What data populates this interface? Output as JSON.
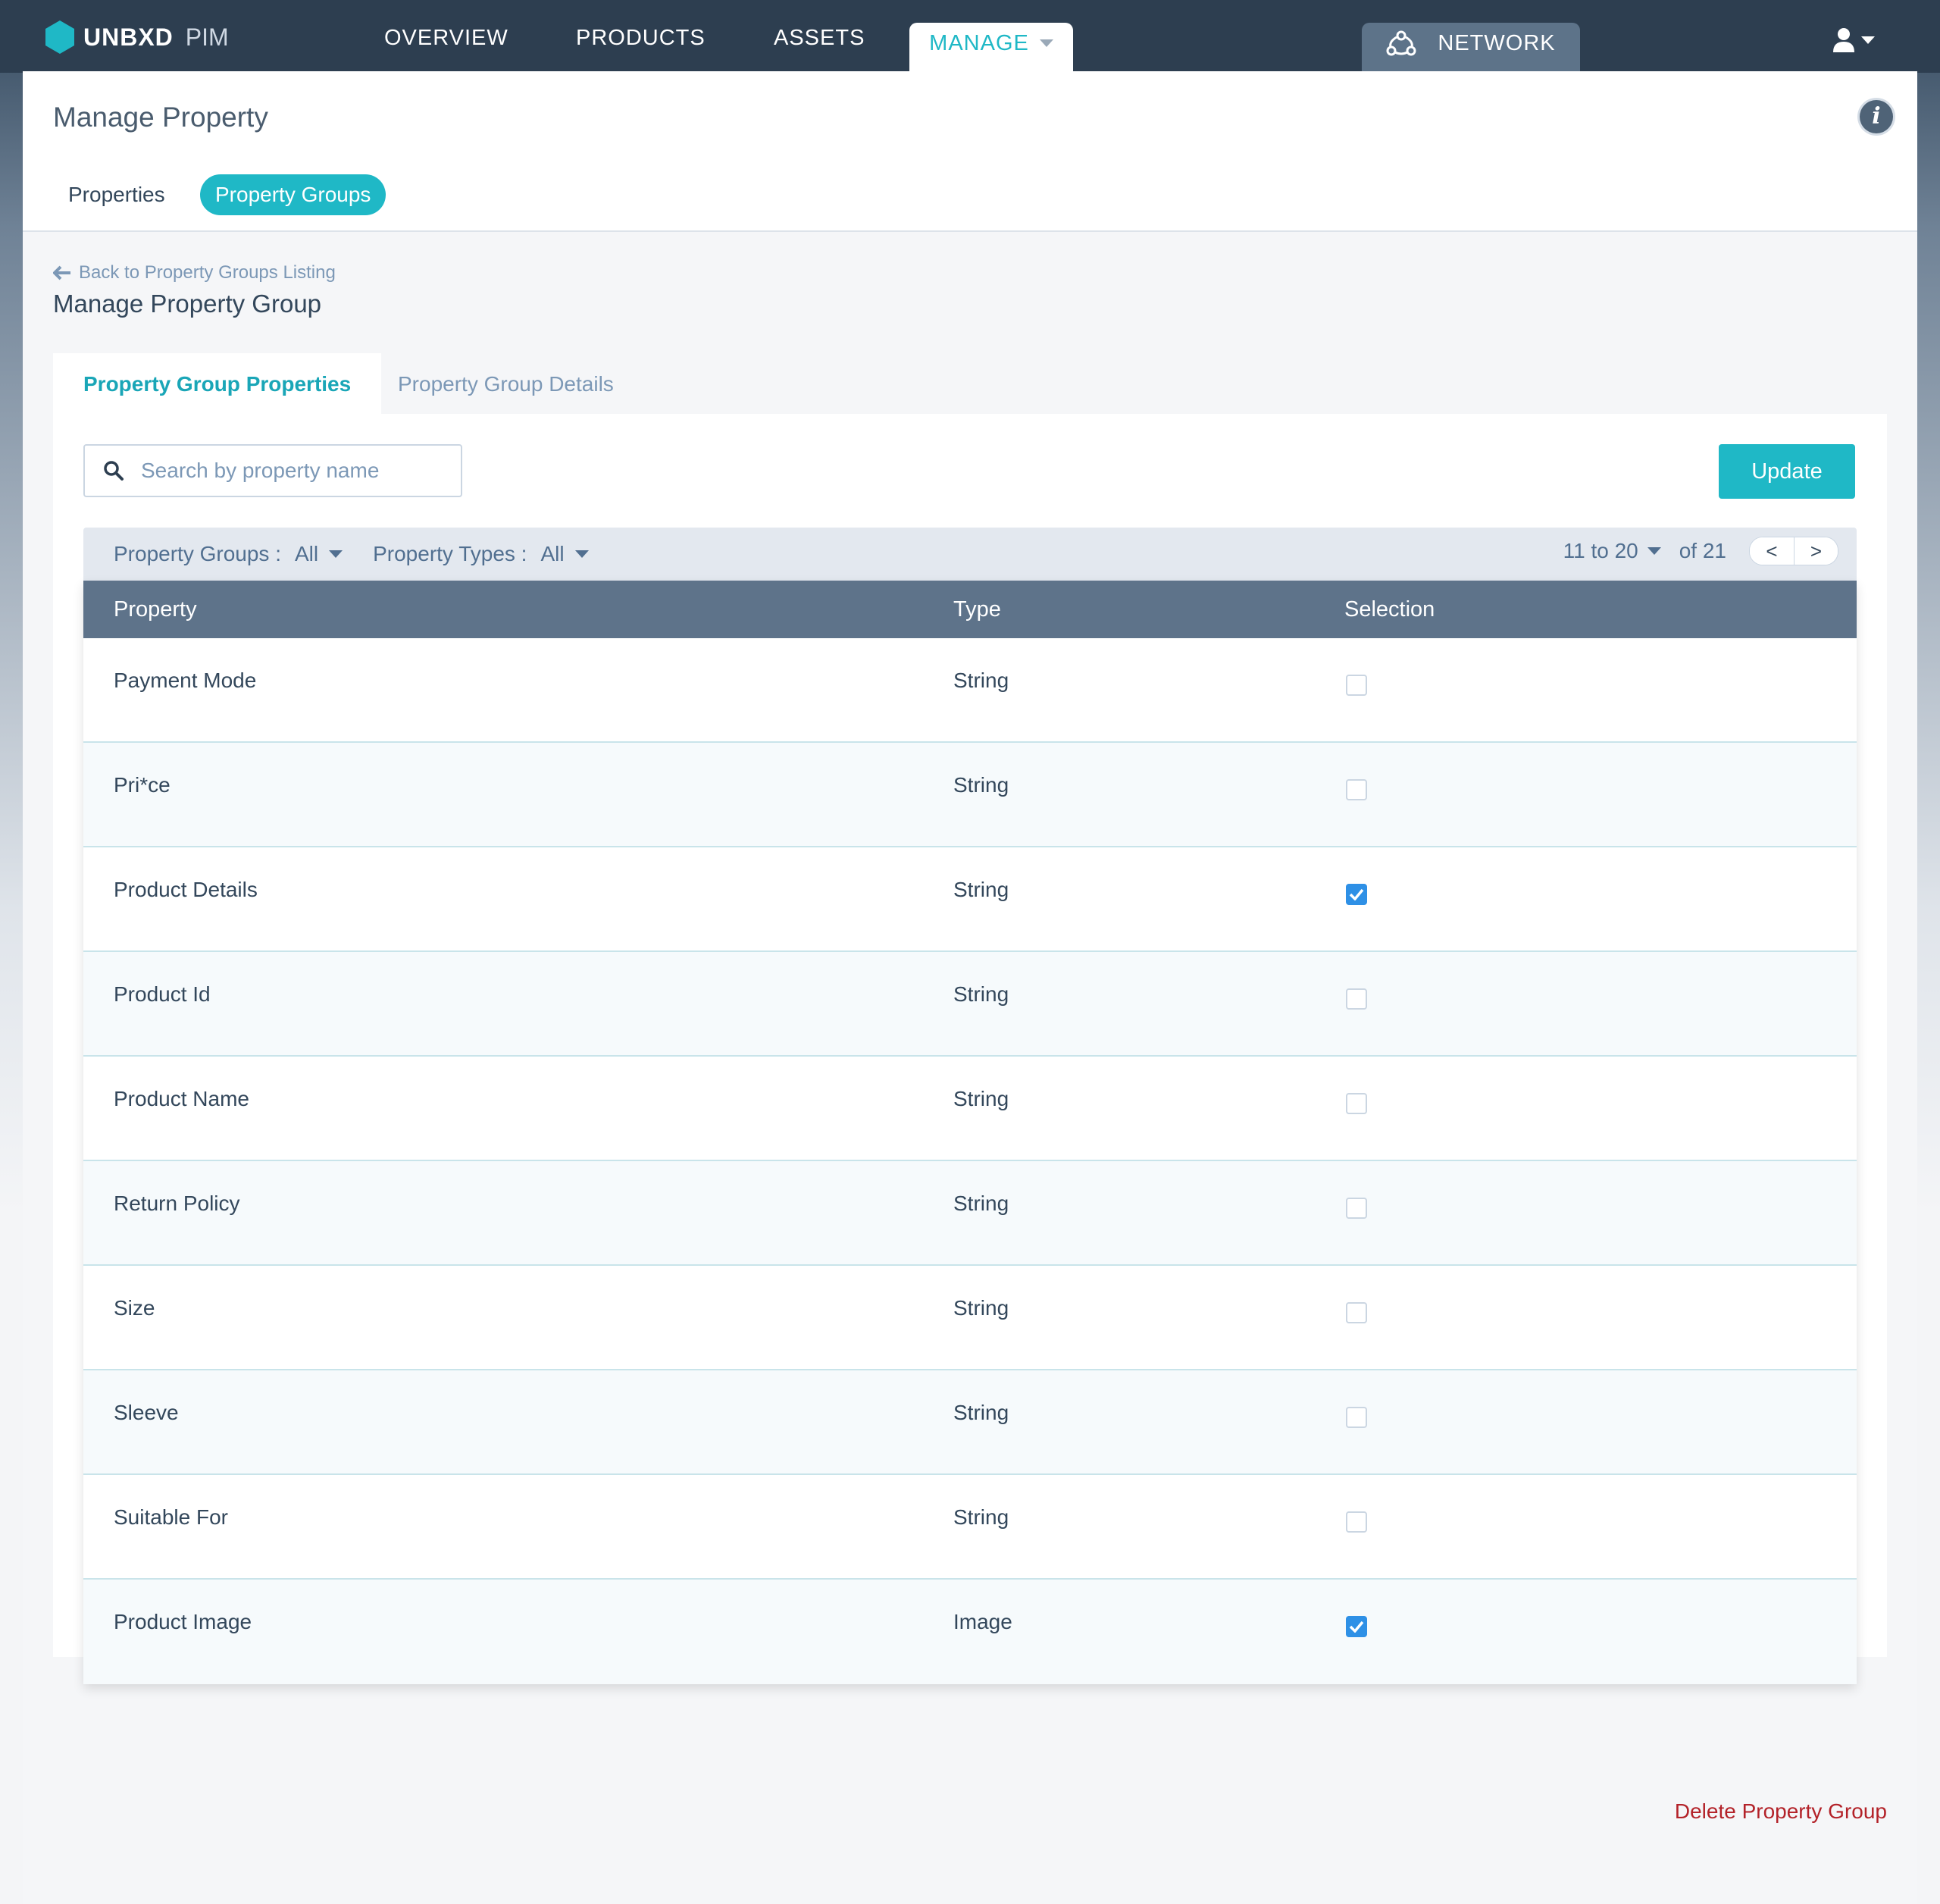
{
  "brand": {
    "name": "UNBXD",
    "product": "PIM",
    "accent": "#1fb8c6"
  },
  "nav": {
    "items": [
      "OVERVIEW",
      "PRODUCTS",
      "ASSETS"
    ],
    "manage": "MANAGE",
    "network": "NETWORK"
  },
  "header": {
    "title": "Manage Property",
    "subtabs": [
      "Properties",
      "Property Groups"
    ],
    "active_subtab": "Property Groups"
  },
  "group": {
    "back_link": "Back to Property Groups Listing",
    "title": "Manage Property Group",
    "tabs": [
      "Property Group Properties",
      "Property Group Details"
    ],
    "active_tab": "Property Group Properties"
  },
  "toolbar": {
    "search_placeholder": "Search by property name",
    "update_label": "Update"
  },
  "filters": {
    "groups_label": "Property Groups :",
    "groups_value": "All",
    "types_label": "Property Types :",
    "types_value": "All"
  },
  "pager": {
    "range": "11 to 20",
    "total": "of 21",
    "prev": "<",
    "next": ">"
  },
  "table": {
    "columns": [
      "Property",
      "Type",
      "Selection"
    ],
    "rows": [
      {
        "property": "Payment Mode",
        "type": "String",
        "selected": false
      },
      {
        "property": "Pri*ce",
        "type": "String",
        "selected": false
      },
      {
        "property": "Product Details",
        "type": "String",
        "selected": true
      },
      {
        "property": "Product Id",
        "type": "String",
        "selected": false
      },
      {
        "property": "Product Name",
        "type": "String",
        "selected": false
      },
      {
        "property": "Return Policy",
        "type": "String",
        "selected": false
      },
      {
        "property": "Size",
        "type": "String",
        "selected": false
      },
      {
        "property": "Sleeve",
        "type": "String",
        "selected": false
      },
      {
        "property": "Suitable For",
        "type": "String",
        "selected": false
      },
      {
        "property": "Product Image",
        "type": "Image",
        "selected": true
      }
    ]
  },
  "footer": {
    "delete_label": "Delete Property Group",
    "delete_color": "#b32229"
  },
  "icons": {
    "logo": "hexagon-logo-icon",
    "network": "network-icon",
    "user": "user-icon",
    "info": "info-icon",
    "back": "arrow-left-icon",
    "search": "search-icon",
    "caret": "caret-down-icon",
    "check": "checkmark-icon"
  }
}
